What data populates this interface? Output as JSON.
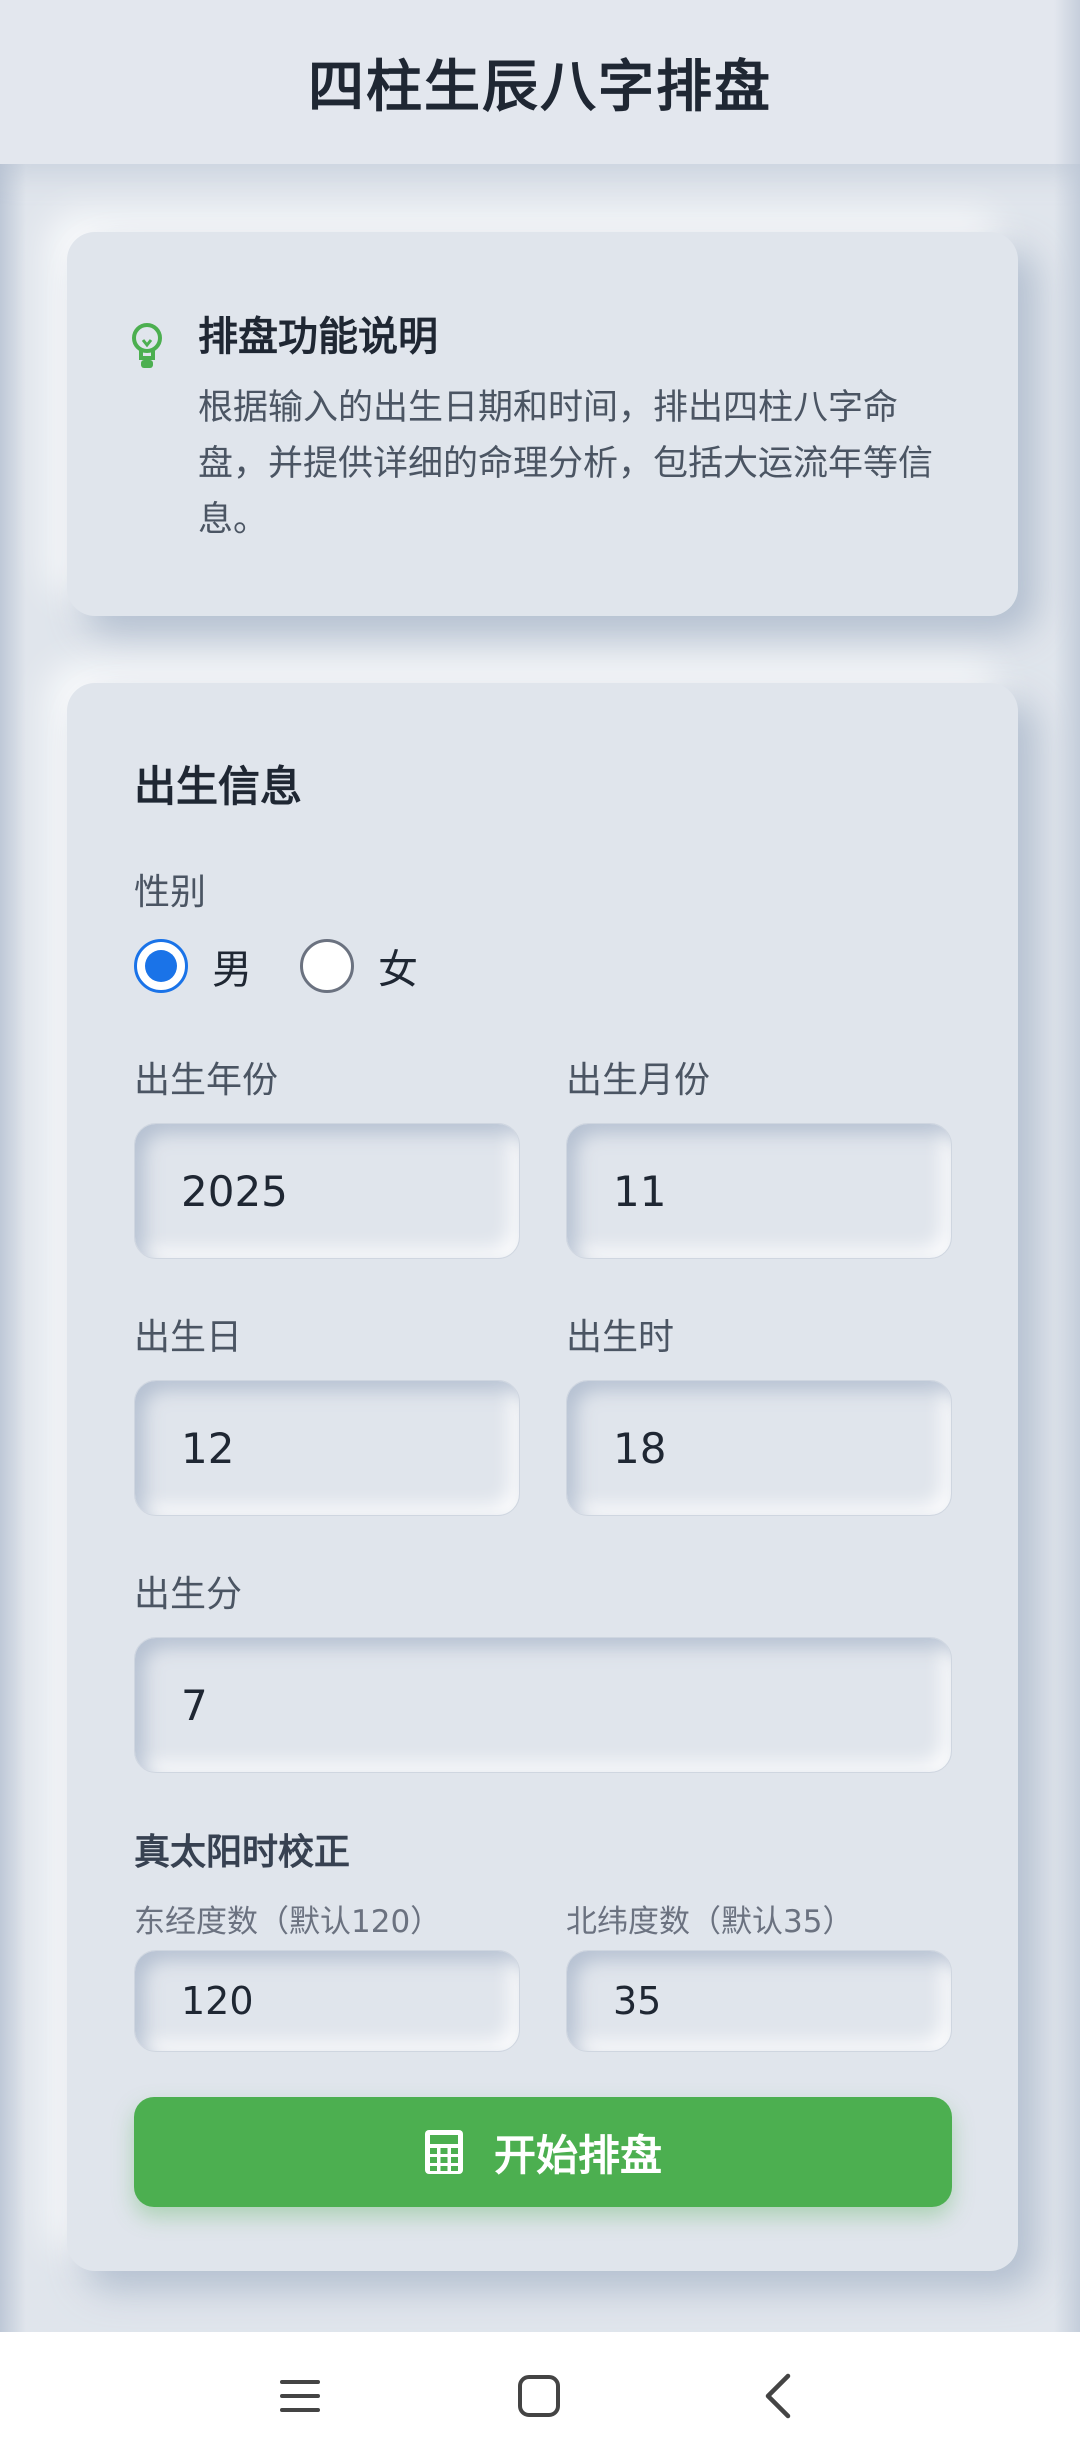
{
  "header": {
    "title": "四柱生辰八字排盘"
  },
  "info": {
    "icon": "lightbulb-icon",
    "title": "排盘功能说明",
    "description": "根据输入的出生日期和时间，排出四柱八字命盘，并提供详细的命理分析，包括大运流年等信息。"
  },
  "form": {
    "title": "出生信息",
    "gender": {
      "label": "性别",
      "options": [
        {
          "label": "男",
          "checked": true
        },
        {
          "label": "女",
          "checked": false
        }
      ]
    },
    "year": {
      "label": "出生年份",
      "value": "2025"
    },
    "month": {
      "label": "出生月份",
      "value": "11"
    },
    "day": {
      "label": "出生日",
      "value": "12"
    },
    "hour": {
      "label": "出生时",
      "value": "18"
    },
    "minute": {
      "label": "出生分",
      "value": "7"
    },
    "solar": {
      "label": "真太阳时校正",
      "longitude": {
        "label": "东经度数（默认120）",
        "value": "120"
      },
      "latitude": {
        "label": "北纬度数（默认35）",
        "value": "35"
      }
    },
    "submit": {
      "label": "开始排盘",
      "icon": "calculator-icon"
    }
  },
  "colors": {
    "accent": "#4caf50",
    "radio": "#1a73e8",
    "background": "#e0e5ec"
  },
  "navbar": {
    "icons": [
      "menu-icon",
      "home-square-icon",
      "back-icon"
    ]
  }
}
